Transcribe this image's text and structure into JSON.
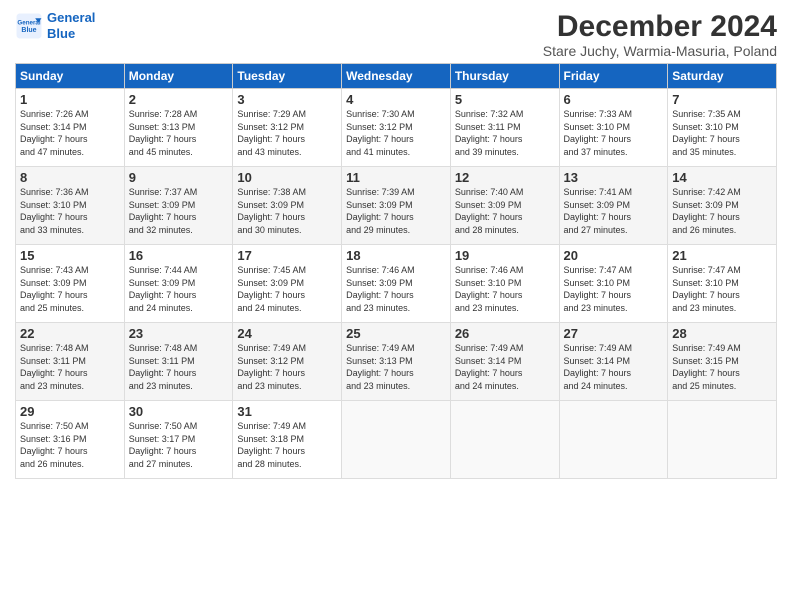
{
  "header": {
    "logo_line1": "General",
    "logo_line2": "Blue",
    "title": "December 2024",
    "subtitle": "Stare Juchy, Warmia-Masuria, Poland"
  },
  "columns": [
    "Sunday",
    "Monday",
    "Tuesday",
    "Wednesday",
    "Thursday",
    "Friday",
    "Saturday"
  ],
  "weeks": [
    [
      {
        "day": "1",
        "info": "Sunrise: 7:26 AM\nSunset: 3:14 PM\nDaylight: 7 hours\nand 47 minutes."
      },
      {
        "day": "2",
        "info": "Sunrise: 7:28 AM\nSunset: 3:13 PM\nDaylight: 7 hours\nand 45 minutes."
      },
      {
        "day": "3",
        "info": "Sunrise: 7:29 AM\nSunset: 3:12 PM\nDaylight: 7 hours\nand 43 minutes."
      },
      {
        "day": "4",
        "info": "Sunrise: 7:30 AM\nSunset: 3:12 PM\nDaylight: 7 hours\nand 41 minutes."
      },
      {
        "day": "5",
        "info": "Sunrise: 7:32 AM\nSunset: 3:11 PM\nDaylight: 7 hours\nand 39 minutes."
      },
      {
        "day": "6",
        "info": "Sunrise: 7:33 AM\nSunset: 3:10 PM\nDaylight: 7 hours\nand 37 minutes."
      },
      {
        "day": "7",
        "info": "Sunrise: 7:35 AM\nSunset: 3:10 PM\nDaylight: 7 hours\nand 35 minutes."
      }
    ],
    [
      {
        "day": "8",
        "info": "Sunrise: 7:36 AM\nSunset: 3:10 PM\nDaylight: 7 hours\nand 33 minutes."
      },
      {
        "day": "9",
        "info": "Sunrise: 7:37 AM\nSunset: 3:09 PM\nDaylight: 7 hours\nand 32 minutes."
      },
      {
        "day": "10",
        "info": "Sunrise: 7:38 AM\nSunset: 3:09 PM\nDaylight: 7 hours\nand 30 minutes."
      },
      {
        "day": "11",
        "info": "Sunrise: 7:39 AM\nSunset: 3:09 PM\nDaylight: 7 hours\nand 29 minutes."
      },
      {
        "day": "12",
        "info": "Sunrise: 7:40 AM\nSunset: 3:09 PM\nDaylight: 7 hours\nand 28 minutes."
      },
      {
        "day": "13",
        "info": "Sunrise: 7:41 AM\nSunset: 3:09 PM\nDaylight: 7 hours\nand 27 minutes."
      },
      {
        "day": "14",
        "info": "Sunrise: 7:42 AM\nSunset: 3:09 PM\nDaylight: 7 hours\nand 26 minutes."
      }
    ],
    [
      {
        "day": "15",
        "info": "Sunrise: 7:43 AM\nSunset: 3:09 PM\nDaylight: 7 hours\nand 25 minutes."
      },
      {
        "day": "16",
        "info": "Sunrise: 7:44 AM\nSunset: 3:09 PM\nDaylight: 7 hours\nand 24 minutes."
      },
      {
        "day": "17",
        "info": "Sunrise: 7:45 AM\nSunset: 3:09 PM\nDaylight: 7 hours\nand 24 minutes."
      },
      {
        "day": "18",
        "info": "Sunrise: 7:46 AM\nSunset: 3:09 PM\nDaylight: 7 hours\nand 23 minutes."
      },
      {
        "day": "19",
        "info": "Sunrise: 7:46 AM\nSunset: 3:10 PM\nDaylight: 7 hours\nand 23 minutes."
      },
      {
        "day": "20",
        "info": "Sunrise: 7:47 AM\nSunset: 3:10 PM\nDaylight: 7 hours\nand 23 minutes."
      },
      {
        "day": "21",
        "info": "Sunrise: 7:47 AM\nSunset: 3:10 PM\nDaylight: 7 hours\nand 23 minutes."
      }
    ],
    [
      {
        "day": "22",
        "info": "Sunrise: 7:48 AM\nSunset: 3:11 PM\nDaylight: 7 hours\nand 23 minutes."
      },
      {
        "day": "23",
        "info": "Sunrise: 7:48 AM\nSunset: 3:11 PM\nDaylight: 7 hours\nand 23 minutes."
      },
      {
        "day": "24",
        "info": "Sunrise: 7:49 AM\nSunset: 3:12 PM\nDaylight: 7 hours\nand 23 minutes."
      },
      {
        "day": "25",
        "info": "Sunrise: 7:49 AM\nSunset: 3:13 PM\nDaylight: 7 hours\nand 23 minutes."
      },
      {
        "day": "26",
        "info": "Sunrise: 7:49 AM\nSunset: 3:14 PM\nDaylight: 7 hours\nand 24 minutes."
      },
      {
        "day": "27",
        "info": "Sunrise: 7:49 AM\nSunset: 3:14 PM\nDaylight: 7 hours\nand 24 minutes."
      },
      {
        "day": "28",
        "info": "Sunrise: 7:49 AM\nSunset: 3:15 PM\nDaylight: 7 hours\nand 25 minutes."
      }
    ],
    [
      {
        "day": "29",
        "info": "Sunrise: 7:50 AM\nSunset: 3:16 PM\nDaylight: 7 hours\nand 26 minutes."
      },
      {
        "day": "30",
        "info": "Sunrise: 7:50 AM\nSunset: 3:17 PM\nDaylight: 7 hours\nand 27 minutes."
      },
      {
        "day": "31",
        "info": "Sunrise: 7:49 AM\nSunset: 3:18 PM\nDaylight: 7 hours\nand 28 minutes."
      },
      {
        "day": "",
        "info": ""
      },
      {
        "day": "",
        "info": ""
      },
      {
        "day": "",
        "info": ""
      },
      {
        "day": "",
        "info": ""
      }
    ]
  ]
}
